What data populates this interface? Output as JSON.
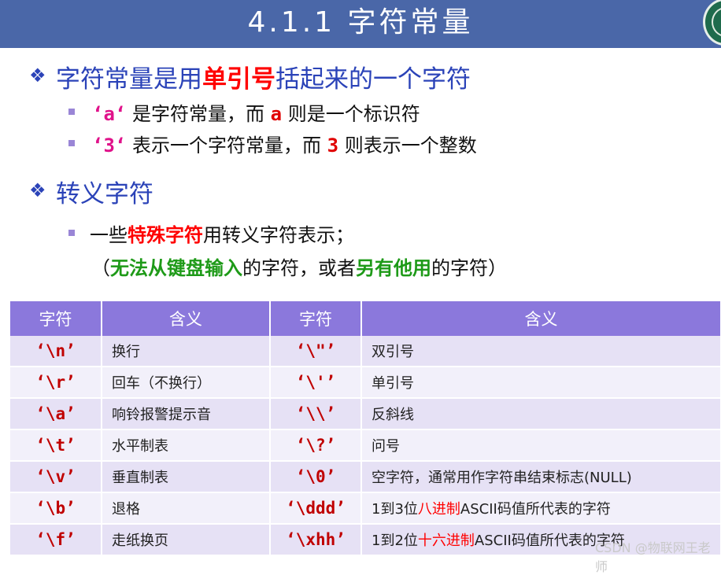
{
  "header": {
    "title": "4.1.1  字符常量"
  },
  "bullets": {
    "symbol": "❖",
    "line1": {
      "prefix": "字符常量是用",
      "bold": "单引号",
      "suffix": "括起来的一个字符"
    },
    "sub1": {
      "code": "‘a‘",
      "mid": "是字符常量，而",
      "code2": "a",
      "end": "则是一个标识符"
    },
    "sub2": {
      "code": "‘3‘",
      "mid": "表示一个字符常量，而",
      "code2": "3",
      "end": "则表示一个整数"
    },
    "line2": {
      "text": "转义字符"
    },
    "sub3": {
      "prefix": "一些",
      "bold": "特殊字符",
      "suffix": "用转义字符表示；"
    },
    "sub4": {
      "open": "（",
      "green1": "无法从键盘输入",
      "mid": "的字符，或者",
      "green2": "另有他用",
      "end": "的字符）"
    }
  },
  "table": {
    "headers": [
      "字符",
      "含义",
      "字符",
      "含义"
    ],
    "rows": [
      {
        "c1": "‘\\n’",
        "m1": "换行",
        "c2": "‘\\\"’",
        "m2": [
          "双引号"
        ]
      },
      {
        "c1": "‘\\r’",
        "m1": "回车（不换行）",
        "c2": "‘\\'’",
        "m2": [
          "单引号"
        ]
      },
      {
        "c1": "‘\\a’",
        "m1": "响铃报警提示音",
        "c2": "‘\\\\’",
        "m2": [
          "反斜线"
        ]
      },
      {
        "c1": "‘\\t’",
        "m1": "水平制表",
        "c2": "‘\\?’",
        "m2": [
          "问号"
        ]
      },
      {
        "c1": "‘\\v’",
        "m1": "垂直制表",
        "c2": "‘\\0’",
        "m2": [
          "空字符，通常用作字符串结束标志(NULL)"
        ]
      },
      {
        "c1": "‘\\b’",
        "m1": "退格",
        "c2": "‘\\ddd’",
        "m2": [
          "1到3位",
          "八进制",
          "ASCII码值所代表的字符"
        ]
      },
      {
        "c1": "‘\\f’",
        "m1": "走纸换页",
        "c2": "‘\\xhh’",
        "m2": [
          "1到2位",
          "十六进制",
          "ASCII码值所代表的字符"
        ]
      }
    ]
  },
  "watermark": "CSDN @物联网王老师"
}
